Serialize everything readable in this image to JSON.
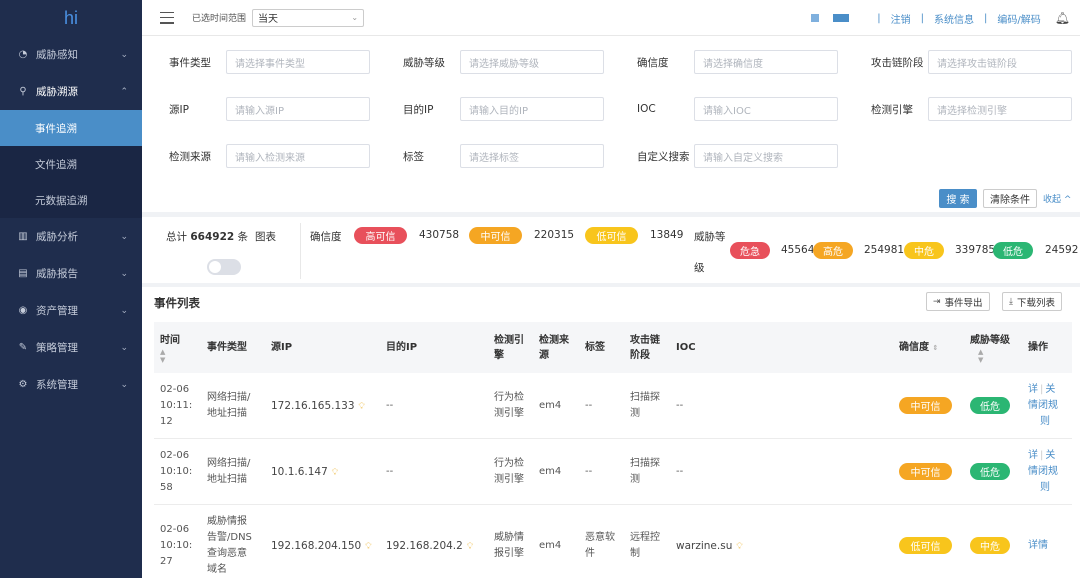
{
  "sidebar": {
    "logo": "hi",
    "items": [
      {
        "label": "威胁感知",
        "icon": "gauge-icon"
      },
      {
        "label": "威胁溯源",
        "icon": "search-icon"
      },
      {
        "label": "威胁分析",
        "icon": "bar-chart-icon"
      },
      {
        "label": "威胁报告",
        "icon": "document-icon"
      },
      {
        "label": "资产管理",
        "icon": "asset-icon"
      },
      {
        "label": "策略管理",
        "icon": "wrench-icon"
      },
      {
        "label": "系统管理",
        "icon": "gear-icon"
      }
    ],
    "subitems": [
      {
        "label": "事件追溯",
        "active": true
      },
      {
        "label": "文件追溯",
        "active": false
      },
      {
        "label": "元数据追溯",
        "active": false
      }
    ]
  },
  "topbar": {
    "time_label": "已选时间范围",
    "time_value": "当天",
    "logout": "注销",
    "sysinfo": "系统信息",
    "codec": "编码/解码",
    "separator": "|"
  },
  "filter": {
    "fields": [
      {
        "label": "事件类型",
        "placeholder": "请选择事件类型"
      },
      {
        "label": "威胁等级",
        "placeholder": "请选择威胁等级"
      },
      {
        "label": "确信度",
        "placeholder": "请选择确信度"
      },
      {
        "label": "攻击链阶段",
        "placeholder": "请选择攻击链阶段"
      },
      {
        "label": "源IP",
        "placeholder": "请输入源IP"
      },
      {
        "label": "目的IP",
        "placeholder": "请输入目的IP"
      },
      {
        "label": "IOC",
        "placeholder": "请输入IOC"
      },
      {
        "label": "检测引擎",
        "placeholder": "请选择检测引擎"
      },
      {
        "label": "检测来源",
        "placeholder": "请输入检测来源"
      },
      {
        "label": "标签",
        "placeholder": "请选择标签"
      },
      {
        "label": "自定义搜索",
        "placeholder": "请输入自定义搜索"
      }
    ],
    "search": "搜 索",
    "clear": "清除条件",
    "collapse": "收起 ^"
  },
  "stats": {
    "total_label": "总计",
    "total": "664922",
    "total_unit": "条",
    "chart": "图表",
    "confidence_label": "确信度",
    "confidence": [
      {
        "label": "高可信",
        "count": "430758",
        "color": "#e8505b"
      },
      {
        "label": "中可信",
        "count": "220315",
        "color": "#f5a623"
      },
      {
        "label": "低可信",
        "count": "13849",
        "color": "#f8c51c"
      }
    ],
    "threat_label_1": "威胁等",
    "threat_label_2": "级",
    "threat": [
      {
        "label": "危急",
        "count": "45564",
        "color": "#e8505b"
      },
      {
        "label": "高危",
        "count": "254981",
        "color": "#f5a623"
      },
      {
        "label": "中危",
        "count": "339785",
        "color": "#f8c51c"
      },
      {
        "label": "低危",
        "count": "24592",
        "color": "#2bb673"
      }
    ]
  },
  "list": {
    "title": "事件列表",
    "export": "事件导出",
    "download": "下载列表",
    "headers": {
      "time": "时间",
      "type": "事件类型",
      "src": "源IP",
      "dst": "目的IP",
      "engine_1": "检测引",
      "engine_2": "擎",
      "source_1": "检测来",
      "source_2": "源",
      "tag": "标签",
      "chain_1": "攻击链",
      "chain_2": "阶段",
      "ioc": "IOC",
      "conf": "确信度",
      "level_1": "威胁等级",
      "op": "操作"
    },
    "rows": [
      {
        "time": [
          "02-06",
          "10:11:",
          "12"
        ],
        "type": [
          "网络扫描/",
          "地址扫描"
        ],
        "src": "172.16.165.133",
        "dst": "--",
        "engine": [
          "行为检",
          "测引擎"
        ],
        "source": "em4",
        "tag": "--",
        "chain": [
          "扫描探",
          "测"
        ],
        "ioc": "--",
        "conf": "中可信",
        "conf_color": "#f5a623",
        "level": "低危",
        "level_color": "#2bb673",
        "ops": [
          "详",
          "关",
          "情闭规",
          "则"
        ]
      },
      {
        "time": [
          "02-06",
          "10:10:",
          "58"
        ],
        "type": [
          "网络扫描/",
          "地址扫描"
        ],
        "src": "10.1.6.147",
        "dst": "--",
        "engine": [
          "行为检",
          "测引擎"
        ],
        "source": "em4",
        "tag": "--",
        "chain": [
          "扫描探",
          "测"
        ],
        "ioc": "--",
        "conf": "中可信",
        "conf_color": "#f5a623",
        "level": "低危",
        "level_color": "#2bb673",
        "ops": [
          "详",
          "关",
          "情闭规",
          "则"
        ]
      },
      {
        "time": [
          "02-06",
          "10:10:",
          "27"
        ],
        "type": [
          "威胁情报",
          "告警/DNS",
          "查询恶意",
          "域名"
        ],
        "src": "192.168.204.150",
        "dst": "192.168.204.2",
        "engine": [
          "威胁情",
          "报引擎"
        ],
        "source": "em4",
        "tag": [
          "恶意软",
          "件"
        ],
        "chain": [
          "远程控",
          "制"
        ],
        "ioc": "warzine.su",
        "conf": "低可信",
        "conf_color": "#f8c51c",
        "level": "中危",
        "level_color": "#f8c51c",
        "ops": [
          "详情"
        ]
      }
    ]
  }
}
